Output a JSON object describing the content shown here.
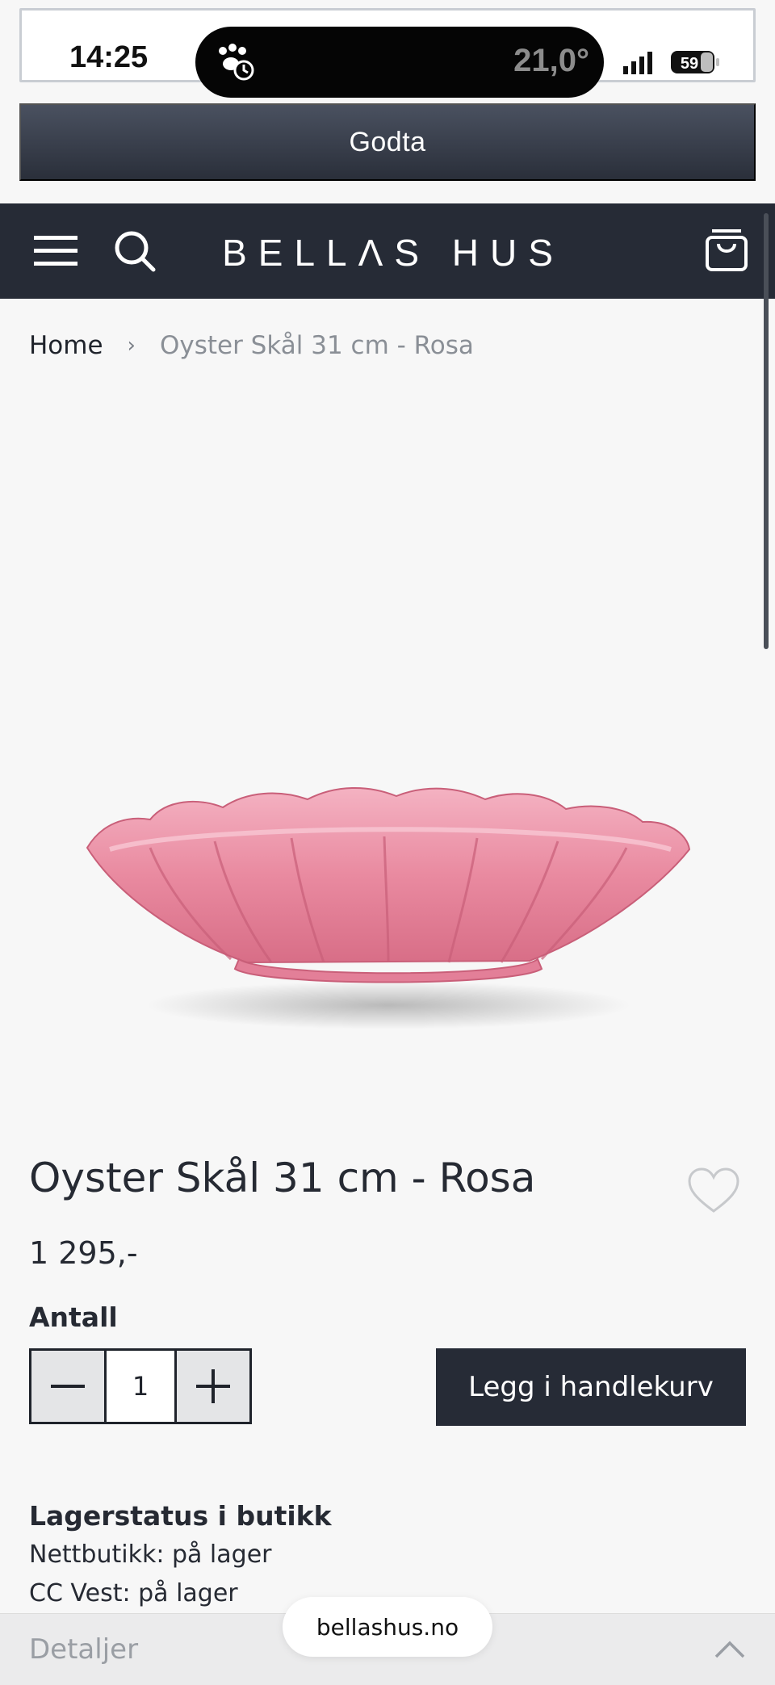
{
  "status_bar": {
    "time": "14:25",
    "temperature": "21,0°",
    "battery": "59",
    "icons": [
      "paw-clock-icon",
      "signal-icon",
      "battery-icon"
    ]
  },
  "consent": {
    "accept_label": "Godta"
  },
  "header": {
    "logo": "BELLΛS HUS",
    "icons": [
      "menu-icon",
      "search-icon",
      "cart-icon"
    ],
    "background": "#262b36"
  },
  "breadcrumb": {
    "home": "Home",
    "separator": "›",
    "current": "Oyster Skål 31 cm - Rosa"
  },
  "product": {
    "title": "Oyster Skål 31 cm - Rosa",
    "price": "1 295,-",
    "quantity_label": "Antall",
    "quantity": "1",
    "add_to_cart_label": "Legg i handlekurv",
    "image_icon": "pink-scalloped-bowl"
  },
  "stock": {
    "title": "Lagerstatus i butikk",
    "lines": [
      "Nettbutikk: på lager",
      "CC Vest: på lager"
    ]
  },
  "details": {
    "label": "Detaljer"
  },
  "browser": {
    "url": "bellashus.no"
  },
  "colors": {
    "accent_dark": "#262b36",
    "bowl_pink": "#e98aa0"
  }
}
